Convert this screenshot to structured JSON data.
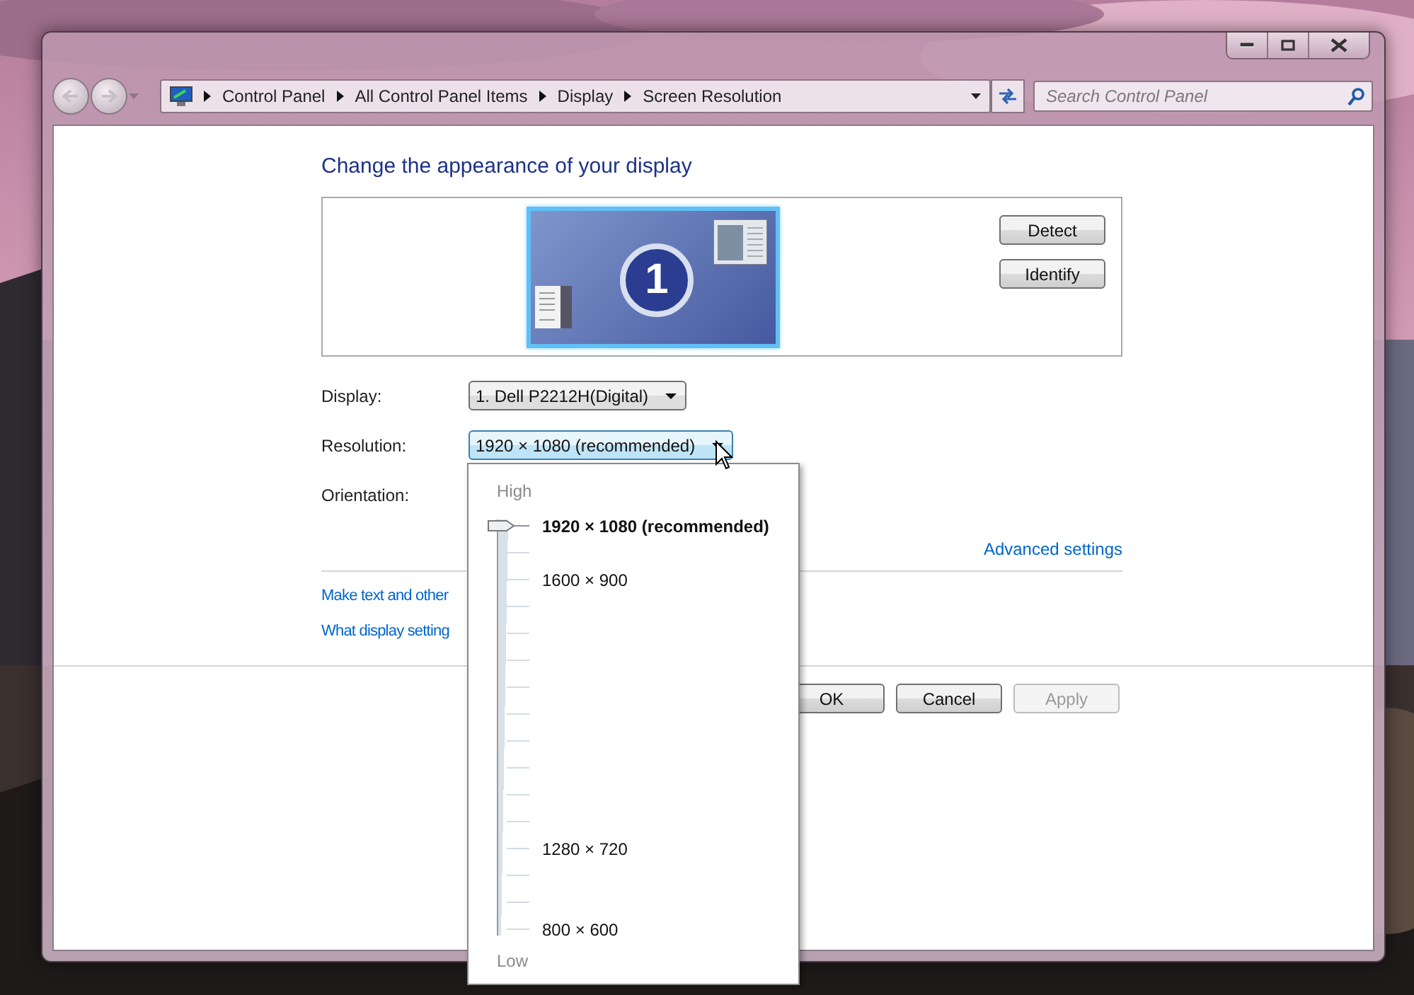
{
  "address_bar": {
    "breadcrumbs": [
      "Control Panel",
      "All Control Panel Items",
      "Display",
      "Screen Resolution"
    ]
  },
  "search": {
    "placeholder": "Search Control Panel"
  },
  "heading": "Change the appearance of your display",
  "monitor": {
    "number": "1",
    "selected": true
  },
  "side_buttons": [
    "Detect",
    "Identify"
  ],
  "fields": [
    {
      "label": "Display:",
      "value": "1. Dell P2212H(Digital)",
      "expanded": false
    },
    {
      "label": "Resolution:",
      "value": "1920 × 1080 (recommended)",
      "expanded": true
    },
    {
      "label": "Orientation:"
    }
  ],
  "advanced_link": "Advanced settings",
  "links": [
    "Make text and other",
    "What display setting"
  ],
  "dialog_buttons": [
    {
      "label": "OK",
      "disabled": false
    },
    {
      "label": "Cancel",
      "disabled": false
    },
    {
      "label": "Apply",
      "disabled": true
    }
  ],
  "resolution_popup": {
    "high_label": "High",
    "low_label": "Low",
    "level": 1,
    "stops": [
      {
        "label": "1920 × 1080 (recommended)",
        "selected": true
      },
      {
        "selected": false
      },
      {
        "label": "1600 × 900",
        "selected": false
      },
      {
        "selected": false
      },
      {
        "selected": false
      },
      {
        "selected": false
      },
      {
        "selected": false
      },
      {
        "selected": false
      },
      {
        "selected": false
      },
      {
        "selected": false
      },
      {
        "selected": false
      },
      {
        "selected": false
      },
      {
        "label": "1280 × 720",
        "selected": false
      },
      {
        "selected": false
      },
      {
        "selected": false
      },
      {
        "label": "800 × 600",
        "selected": false
      }
    ]
  }
}
